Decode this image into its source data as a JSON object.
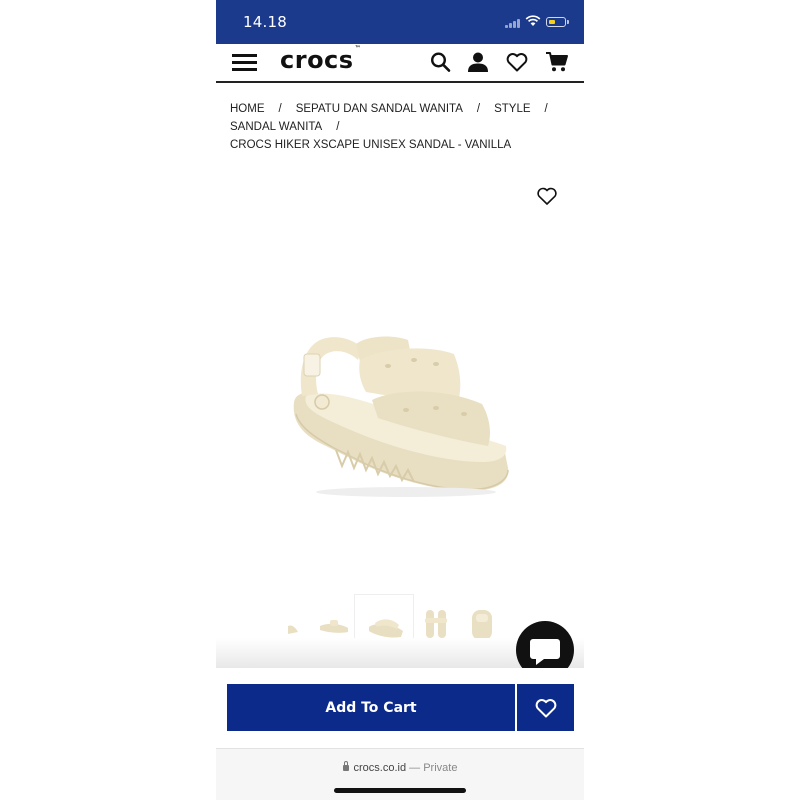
{
  "status_bar": {
    "time": "14.18"
  },
  "header": {
    "logo_text": "crocs",
    "logo_mark": "™",
    "icons": [
      "menu-icon",
      "search-icon",
      "account-icon",
      "wishlist-heart-icon",
      "cart-icon"
    ]
  },
  "breadcrumb": {
    "items": [
      "HOME",
      "SEPATU DAN SANDAL WANITA",
      "STYLE",
      "SANDAL WANITA"
    ],
    "separator": "/",
    "current": "CROCS HIKER XSCAPE UNISEX SANDAL - VANILLA"
  },
  "product": {
    "color_hex": "#efe6cc",
    "thumbnail_count": 5,
    "selected_thumbnail_index": 2
  },
  "actions": {
    "add_to_cart_label": "Add To Cart",
    "button_color": "#0b2a8a"
  },
  "browser": {
    "domain": "crocs.co.id",
    "separator": "—",
    "mode": "Private"
  },
  "colors": {
    "status_bar": "#1b3a8c",
    "battery": "#f7d21d"
  }
}
